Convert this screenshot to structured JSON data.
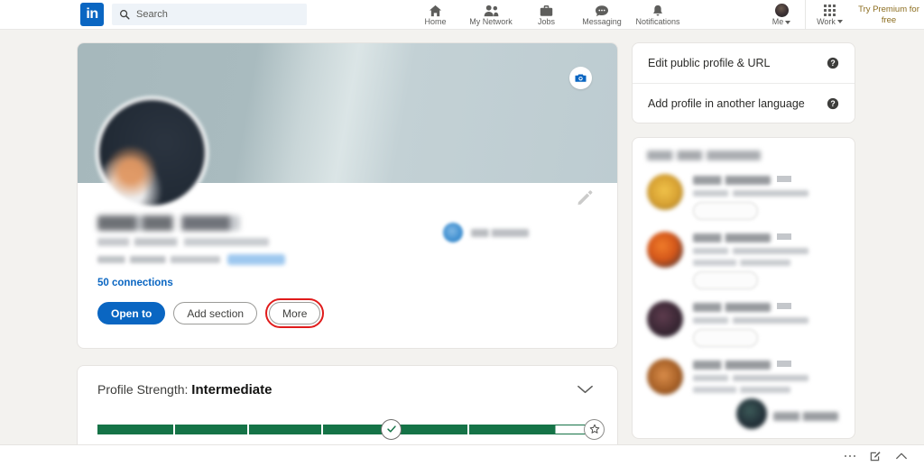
{
  "nav": {
    "logo_text": "in",
    "search_placeholder": "Search",
    "items": [
      {
        "label": "Home",
        "icon": "home-icon"
      },
      {
        "label": "My Network",
        "icon": "people-icon"
      },
      {
        "label": "Jobs",
        "icon": "briefcase-icon"
      },
      {
        "label": "Messaging",
        "icon": "message-icon"
      },
      {
        "label": "Notifications",
        "icon": "bell-icon"
      }
    ],
    "me_label": "Me",
    "work_label": "Work",
    "premium_label": "Try Premium for free"
  },
  "profile": {
    "cover_camera_icon": "camera-icon",
    "edit_icon": "pencil-icon",
    "connections": "50 connections",
    "buttons": {
      "open_to": "Open to",
      "add_section": "Add section",
      "more": "More"
    },
    "highlight_color": "#e01b1b",
    "primary_color": "#0a66c2"
  },
  "strength": {
    "label": "Profile Strength:",
    "level": "Intermediate",
    "chevron_icon": "chevron-down-icon",
    "check_icon": "check-icon",
    "star_icon": "star-icon",
    "bar_color": "#157347",
    "segments": [
      {
        "fill": "full"
      },
      {
        "fill": "full"
      },
      {
        "fill": "full"
      },
      {
        "fill": "full"
      },
      {
        "fill": "full"
      },
      {
        "fill": "partial"
      }
    ]
  },
  "sidebar": {
    "links": [
      {
        "label": "Edit public profile & URL",
        "icon": "help-icon"
      },
      {
        "label": "Add profile in another language",
        "icon": "help-icon"
      }
    ],
    "people_also_viewed": {
      "title_redacted": true,
      "items": [
        {
          "avatar": "av1"
        },
        {
          "avatar": "av2"
        },
        {
          "avatar": "av3"
        },
        {
          "avatar": "av4"
        }
      ]
    }
  },
  "taskbar": {
    "more_icon": "ellipsis-icon",
    "compose_icon": "compose-icon",
    "expand_icon": "chevron-up-icon"
  }
}
